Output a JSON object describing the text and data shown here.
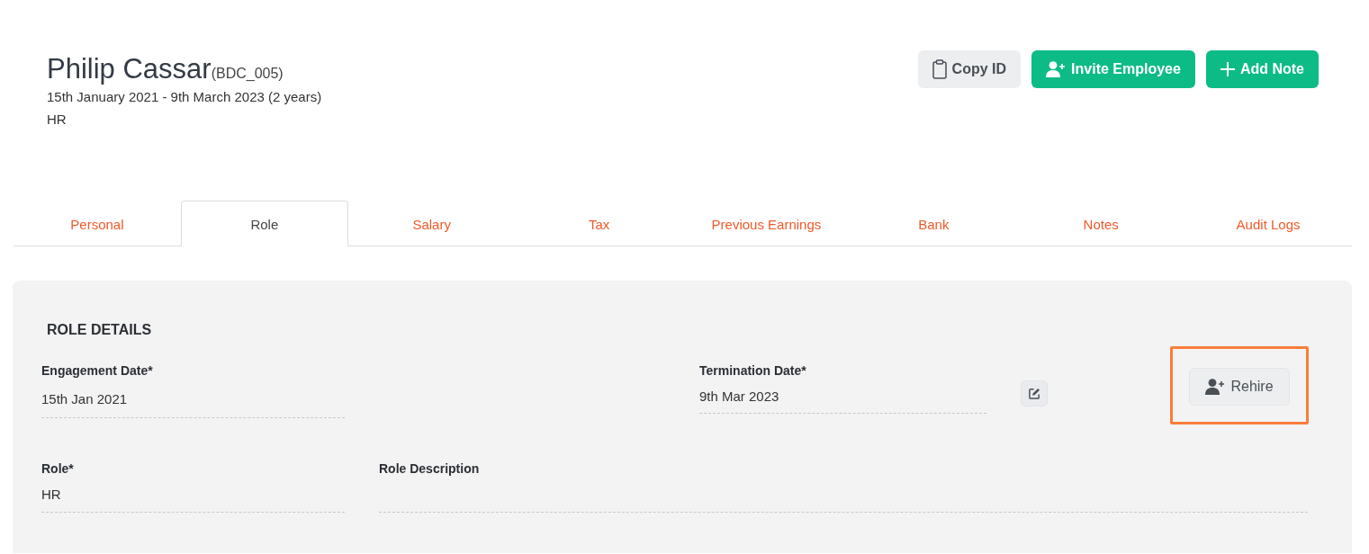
{
  "employee": {
    "name": "Philip Cassar",
    "code": "(BDC_005)",
    "period": "15th January 2021 - 9th March 2023 (2 years)",
    "department": "HR"
  },
  "actions": [
    {
      "kind": "copy",
      "label": "Copy ID"
    },
    {
      "kind": "invite",
      "label": "Invite Employee"
    },
    {
      "kind": "add",
      "label": "Add Note"
    }
  ],
  "tabs": [
    {
      "label": "Personal",
      "selected": false
    },
    {
      "label": "Role",
      "selected": true
    },
    {
      "label": "Salary",
      "selected": false
    },
    {
      "label": "Tax",
      "selected": false
    },
    {
      "label": "Previous Earnings",
      "selected": false
    },
    {
      "label": "Bank",
      "selected": false
    },
    {
      "label": "Notes",
      "selected": false
    },
    {
      "label": "Audit Logs",
      "selected": false
    }
  ],
  "role_details": {
    "title": "ROLE DETAILS",
    "engagement_date": {
      "label": "Engagement Date*",
      "value": "15th Jan 2021"
    },
    "termination_date": {
      "label": "Termination Date*",
      "value": "9th Mar 2023"
    },
    "rehire_button": {
      "label": "Rehire",
      "highlighted": true
    },
    "role": {
      "label": "Role*",
      "value": "HR"
    },
    "role_description": {
      "label": "Role Description"
    }
  }
}
